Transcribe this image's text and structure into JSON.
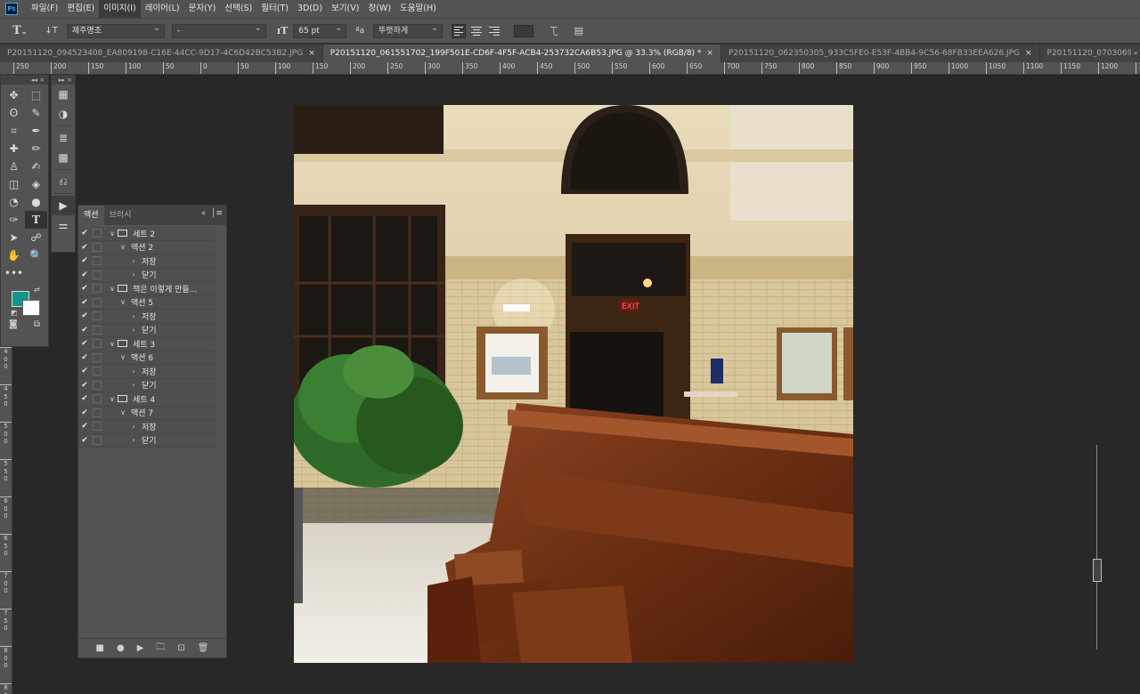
{
  "app": {
    "logo": "Ps"
  },
  "menu": [
    "파일(F)",
    "편집(E)",
    "이미지(I)",
    "레이어(L)",
    "문자(Y)",
    "선택(S)",
    "필터(T)",
    "3D(D)",
    "보기(V)",
    "창(W)",
    "도움말(H)"
  ],
  "menu_active_index": 2,
  "options": {
    "font_family": "제주명조",
    "font_style": "-",
    "font_size": "65 pt",
    "aa_icon_label": "ªa",
    "antialias": "뚜렷하게",
    "text_color": "#3a3a3a"
  },
  "tabs": [
    {
      "label": "P20151120_094523408_EA809198-C16E-44CC-9D17-4C6D42BC53B2.JPG",
      "close": "×",
      "active": false
    },
    {
      "label": "P20151120_061551702_199F501E-CD6F-4F5F-ACB4-253732CA6B53.JPG @ 33.3% (RGB/8) *",
      "close": "×",
      "active": true
    },
    {
      "label": "P20151120_062350305_933C5FE0-E53F-4BB4-9C56-68FB33EEA626.JPG",
      "close": "×",
      "active": false
    },
    {
      "label": "P20151120_070306956_71380804-9",
      "close": "",
      "active": false
    }
  ],
  "tab_overflow": "»",
  "ruler_top": [
    "250",
    "200",
    "150",
    "100",
    "50",
    "0",
    "50",
    "100",
    "150",
    "200",
    "250",
    "300",
    "350",
    "400",
    "450",
    "500",
    "550",
    "600",
    "650",
    "700",
    "750",
    "800",
    "850",
    "900",
    "950",
    "1000",
    "1050",
    "1100",
    "1150",
    "1200",
    "1250"
  ],
  "ruler_left": [
    "0",
    "50",
    "100",
    "150",
    "200",
    "250",
    "300",
    "350",
    "400",
    "450",
    "500",
    "550",
    "600",
    "650",
    "700",
    "750",
    "800",
    "850"
  ],
  "toolbox": {
    "collapse_label": "◂◂ ×",
    "tools": [
      "move-tool-icon",
      "marquee-tool-icon",
      "lasso-tool-icon",
      "quick-select-tool-icon",
      "crop-tool-icon",
      "eyedropper-tool-icon",
      "healing-tool-icon",
      "brush-tool-icon",
      "stamp-tool-icon",
      "history-brush-icon",
      "eraser-tool-icon",
      "bucket-tool-icon",
      "blur-tool-icon",
      "dodge-tool-icon",
      "pen-tool-icon",
      "type-tool-icon",
      "path-select-tool-icon",
      "shape-tool-icon",
      "hand-tool-icon",
      "zoom-tool-icon",
      "more-tools-icon"
    ],
    "tool_glyphs": [
      "✥",
      "⬚",
      "ʘ",
      "✎",
      "⌗",
      "✒",
      "✚",
      "✏",
      "♙",
      "✍",
      "◫",
      "◈",
      "◔",
      "●",
      "✑",
      "T",
      "➤",
      "☍",
      "✋",
      "🔍",
      "•••"
    ],
    "active_tool": "type-tool-icon",
    "foreground_color": "#14958f",
    "background_color": "#ffffff"
  },
  "dock": {
    "collapse_label": "▸▸ ×"
  },
  "actions_panel": {
    "tabs": [
      "액션",
      "브러시"
    ],
    "active_tab": 0,
    "rows": [
      {
        "indent": 0,
        "type": "set",
        "expanded": true,
        "label": "세트 2"
      },
      {
        "indent": 1,
        "type": "action",
        "expanded": true,
        "label": "액션 2"
      },
      {
        "indent": 2,
        "type": "step",
        "expanded": false,
        "label": "저장"
      },
      {
        "indent": 2,
        "type": "step",
        "expanded": false,
        "label": "닫기"
      },
      {
        "indent": 0,
        "type": "set",
        "expanded": true,
        "label": "책은 이렇게 만들..."
      },
      {
        "indent": 1,
        "type": "action",
        "expanded": true,
        "label": "액션 5"
      },
      {
        "indent": 2,
        "type": "step",
        "expanded": false,
        "label": "저장"
      },
      {
        "indent": 2,
        "type": "step",
        "expanded": false,
        "label": "닫기"
      },
      {
        "indent": 0,
        "type": "set",
        "expanded": true,
        "label": "세트 3"
      },
      {
        "indent": 1,
        "type": "action",
        "expanded": true,
        "label": "액션 6"
      },
      {
        "indent": 2,
        "type": "step",
        "expanded": false,
        "label": "저장"
      },
      {
        "indent": 2,
        "type": "step",
        "expanded": false,
        "label": "닫기"
      },
      {
        "indent": 0,
        "type": "set",
        "expanded": true,
        "label": "세트 4"
      },
      {
        "indent": 1,
        "type": "action",
        "expanded": true,
        "label": "액션 7"
      },
      {
        "indent": 2,
        "type": "step",
        "expanded": false,
        "label": "저장"
      },
      {
        "indent": 2,
        "type": "step",
        "expanded": false,
        "label": "닫기"
      }
    ],
    "footer": [
      "■",
      "●",
      "▶",
      "🗀",
      "⊡",
      "🗑"
    ]
  },
  "canvas": {
    "exit_sign": "EXIT"
  }
}
